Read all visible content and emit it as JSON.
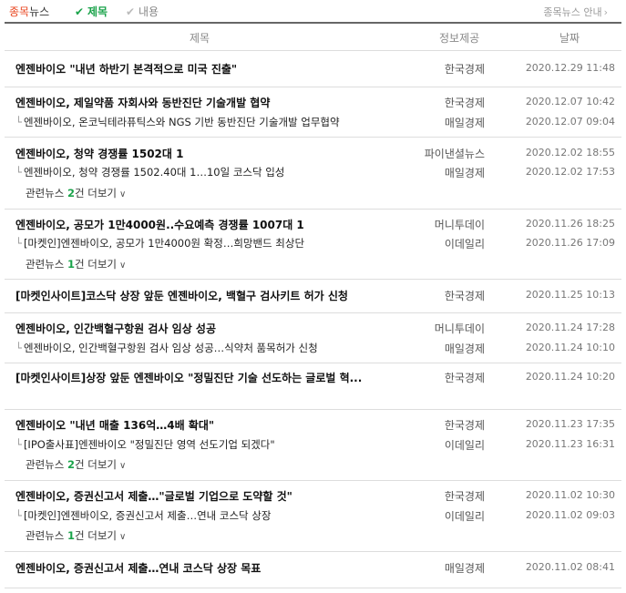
{
  "toolbar": {
    "stock_highlight": "종목",
    "stock_rest": "뉴스",
    "opt_title": "제목",
    "opt_body": "내용",
    "guide": "종목뉴스 안내"
  },
  "header": {
    "title": "제목",
    "source": "정보제공",
    "date": "날짜"
  },
  "articles": [
    {
      "title": "엔젠바이오 \"내년 하반기 본격적으로 미국 진출\"",
      "source": "한국경제",
      "date": "2020.12.29 11:48"
    },
    {
      "title": "엔젠바이오, 제일약품 자회사와 동반진단 기술개발 협약",
      "source": "한국경제",
      "date": "2020.12.07 10:42",
      "related": [
        {
          "title": "엔젠바이오, 온코닉테라퓨틱스와 NGS 기반 동반진단 기술개발 업무협약",
          "source": "매일경제",
          "date": "2020.12.07 09:04"
        }
      ]
    },
    {
      "title": "엔젠바이오, 청약 경쟁률 1502대 1",
      "source": "파이낸셜뉴스",
      "date": "2020.12.02 18:55",
      "related": [
        {
          "title": "엔젠바이오, 청약 경쟁률 1502.40대 1…10일 코스닥 입성",
          "source": "매일경제",
          "date": "2020.12.02 17:53"
        }
      ],
      "more": {
        "prefix": "관련뉴스 ",
        "count": "2",
        "suffix": "건 더보기"
      }
    },
    {
      "title": "엔젠바이오, 공모가 1만4000원..수요예측 경쟁률 1007대 1",
      "source": "머니투데이",
      "date": "2020.11.26 18:25",
      "related": [
        {
          "title": "[마켓인]엔젠바이오, 공모가 1만4000원 확정…희망밴드 최상단",
          "source": "이데일리",
          "date": "2020.11.26 17:09"
        }
      ],
      "more": {
        "prefix": "관련뉴스 ",
        "count": "1",
        "suffix": "건 더보기"
      }
    },
    {
      "title": "[마켓인사이트]코스닥 상장 앞둔 엔젠바이오, 백혈구 검사키트 허가 신청",
      "source": "한국경제",
      "date": "2020.11.25 10:13"
    },
    {
      "title": "엔젠바이오, 인간백혈구항원 검사 임상 성공",
      "source": "머니투데이",
      "date": "2020.11.24 17:28",
      "related": [
        {
          "title": "엔젠바이오, 인간백혈구항원 검사 임상 성공…식약처 품목허가 신청",
          "source": "매일경제",
          "date": "2020.11.24 10:10"
        }
      ]
    },
    {
      "title": "[마켓인사이트]상장 앞둔 엔젠바이오 \"정밀진단 기술 선도하는 글로벌 혁...",
      "source": "한국경제",
      "date": "2020.11.24 10:20"
    },
    {
      "title": "엔젠바이오 \"내년 매출 136억…4배 확대\"",
      "source": "한국경제",
      "date": "2020.11.23 17:35",
      "related": [
        {
          "title": "[IPO출사표]엔젠바이오 \"정밀진단 영역 선도기업 되겠다\"",
          "source": "이데일리",
          "date": "2020.11.23 16:31"
        }
      ],
      "more": {
        "prefix": "관련뉴스 ",
        "count": "2",
        "suffix": "건 더보기"
      }
    },
    {
      "title": "엔젠바이오, 증권신고서 제출…\"글로벌 기업으로 도약할 것\"",
      "source": "한국경제",
      "date": "2020.11.02 10:30",
      "related": [
        {
          "title": "[마켓인]엔젠바이오, 증권신고서 제출…연내 코스닥 상장",
          "source": "이데일리",
          "date": "2020.11.02 09:03"
        }
      ],
      "more": {
        "prefix": "관련뉴스 ",
        "count": "1",
        "suffix": "건 더보기"
      }
    },
    {
      "title": "엔젠바이오, 증권신고서 제출…연내 코스닥 상장 목표",
      "source": "매일경제",
      "date": "2020.11.02 08:41"
    }
  ]
}
